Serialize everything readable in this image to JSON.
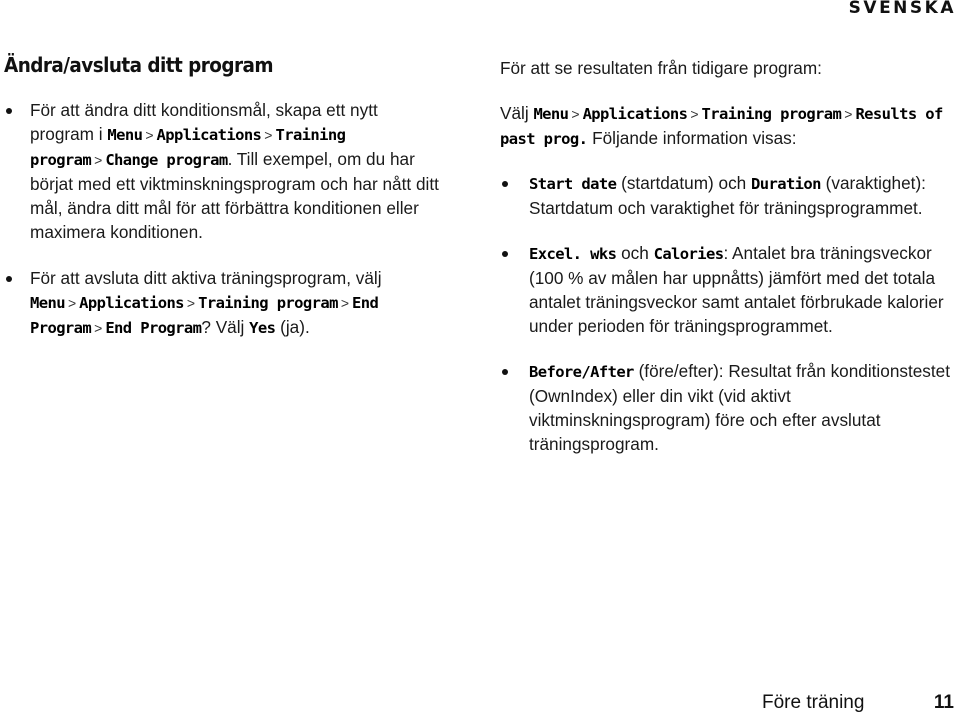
{
  "header": {
    "language_label": "SVENSKA"
  },
  "left": {
    "heading": "Ändra/avsluta ditt program",
    "bullet1": {
      "text_a": "För att ändra ditt konditionsmål, skapa ett nytt program i ",
      "menu": "Menu",
      "applications": "Applications",
      "training_program": "Training program",
      "change_program": "Change program",
      "text_b": ". Till exempel, om du har börjat med ett viktminskningsprogram och har nått ditt mål, ändra ditt mål för att förbättra konditionen eller maximera konditionen."
    },
    "bullet2": {
      "text_a": "För att avsluta ditt aktiva träningsprogram, välj ",
      "menu": "Menu",
      "applications": "Applications",
      "training_program": "Training program",
      "end_program": "End Program",
      "end_program_q": "End Program",
      "text_b": "? Välj ",
      "yes": "Yes",
      "text_c": " (ja)."
    }
  },
  "right": {
    "intro": "För att se resultaten från tidigare program:",
    "path": {
      "text_a": "Välj ",
      "menu": "Menu",
      "applications": "Applications",
      "training_program": "Training program",
      "results": "Results of past prog.",
      "text_b": " Följande information visas:"
    },
    "bullets": [
      {
        "term1": "Start date",
        "text_a": " (startdatum) och ",
        "term2": "Duration",
        "text_b": " (varaktighet): Startdatum och varaktighet för träningsprogrammet."
      },
      {
        "term1": "Excel. wks",
        "text_a": " och ",
        "term2": "Calories",
        "text_b": ": Antalet bra träningsveckor (100 % av målen har uppnåtts) jämfört med det totala antalet träningsveckor samt antalet förbrukade kalorier under perioden för träningsprogrammet."
      },
      {
        "term1": "Before/After",
        "text_b": " (före/efter): Resultat från konditionstestet (OwnIndex) eller din vikt (vid aktivt viktminskningsprogram) före och efter avslutat träningsprogram."
      }
    ]
  },
  "separator": ">",
  "footer": {
    "section_title": "Före träning",
    "page_number": "11"
  }
}
